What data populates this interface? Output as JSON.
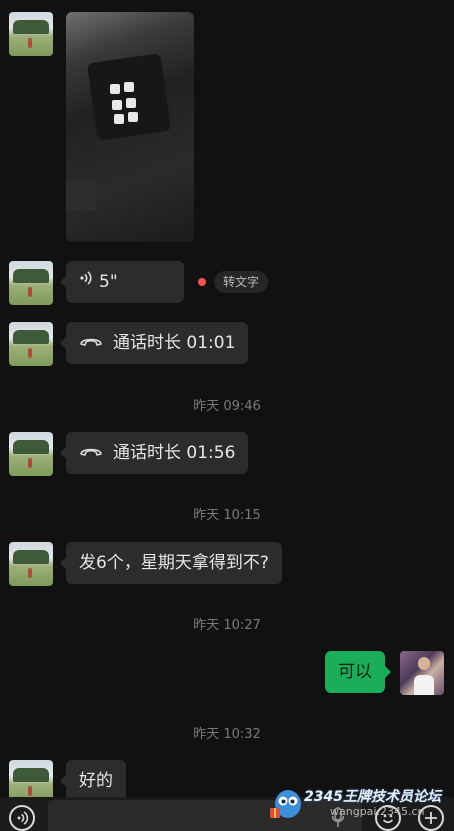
{
  "messages": {
    "voice": {
      "duration": "5\"",
      "transcribe_label": "转文字"
    },
    "call_1": {
      "text": "通话时长 01:01"
    },
    "time_1": "昨天 09:46",
    "call_2": {
      "text": "通话时长 01:56"
    },
    "time_2": "昨天 10:15",
    "text_1": "发6个，星期天拿得到不?",
    "time_3": "昨天 10:27",
    "reply_mine": "可以",
    "time_4": "昨天 10:32",
    "text_2": "好的"
  },
  "watermark": {
    "brand": "2345王牌技术员论坛",
    "site": "wangpai.2345.cn"
  },
  "icons": {
    "voice_mode": "voice-mode-icon",
    "mic": "microphone-icon",
    "emoji": "emoji-icon",
    "add": "add-icon"
  },
  "colors": {
    "background": "#111111",
    "incoming_bubble": "#2c2c2c",
    "outgoing_bubble": "#1aad5a",
    "unread_dot": "#fa5151"
  }
}
